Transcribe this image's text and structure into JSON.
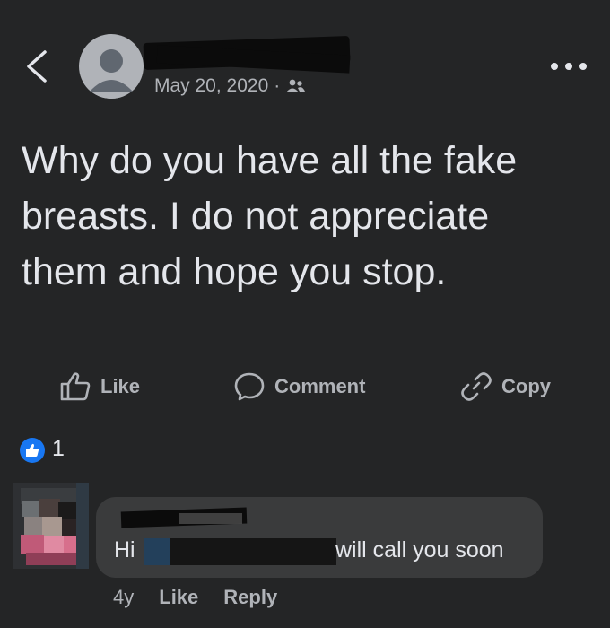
{
  "header": {
    "date": "May 20, 2020",
    "separator": "·",
    "audience_icon": "friends-icon",
    "back_icon": "chevron-left-icon",
    "more_icon": "more-horizontal-icon"
  },
  "post": {
    "text": "Why do you have all the fake breasts.  I do not appreciate them and hope you stop."
  },
  "actions": {
    "like_label": "Like",
    "comment_label": "Comment",
    "copy_label": "Copy"
  },
  "reactions": {
    "icon": "thumbs-up-icon",
    "count": "1",
    "color": "#1877f2"
  },
  "comment": {
    "text_prefix": "Hi",
    "text_suffix": "will call you soon",
    "time": "4y",
    "like_label": "Like",
    "reply_label": "Reply"
  },
  "colors": {
    "background": "#242526",
    "bubble": "#3a3b3c",
    "text_primary": "#e4e6eb",
    "text_secondary": "#b0b3b8"
  }
}
